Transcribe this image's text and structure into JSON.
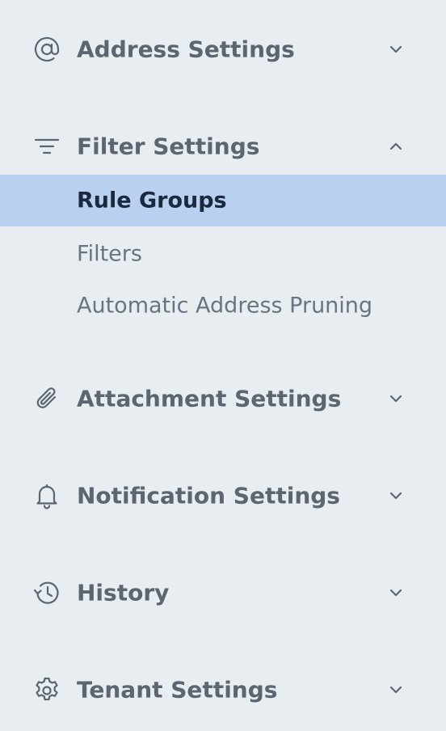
{
  "sections": [
    {
      "label": "Address Settings",
      "icon": "at-sign-icon",
      "state": "collapsed"
    },
    {
      "label": "Filter Settings",
      "icon": "filter-icon",
      "state": "expanded",
      "items": [
        {
          "label": "Rule Groups",
          "active": true
        },
        {
          "label": "Filters",
          "active": false
        },
        {
          "label": "Automatic Address Pruning",
          "active": false
        }
      ]
    },
    {
      "label": "Attachment Settings",
      "icon": "paperclip-icon",
      "state": "collapsed"
    },
    {
      "label": "Notification Settings",
      "icon": "bell-icon",
      "state": "collapsed"
    },
    {
      "label": "History",
      "icon": "history-icon",
      "state": "collapsed"
    },
    {
      "label": "Tenant Settings",
      "icon": "gear-icon",
      "state": "collapsed"
    }
  ],
  "colors": {
    "background": "#e8edf1",
    "text": "#5c6670",
    "active_background": "#bad0f1",
    "active_text": "#1a2a3c"
  }
}
